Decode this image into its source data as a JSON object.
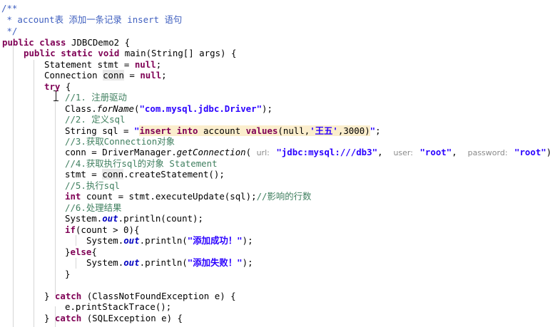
{
  "editor": {
    "lines": [
      {
        "text": "/**"
      },
      {
        "text": " * account表 添加一条记录 insert 语句"
      },
      {
        "text": " */"
      },
      {
        "kw1": "public class",
        "name": "JDBCDemo2 {"
      },
      {
        "kw1": "public static void",
        "rest": "main(String[] args) {"
      },
      {
        "type": "Statement",
        "var": "stmt",
        "eq": " = ",
        "kw": "null",
        "end": ";"
      },
      {
        "type": "Connection",
        "var": "conn",
        "eq": " = ",
        "kw": "null",
        "end": ";"
      },
      {
        "kw": "try",
        "end": " {"
      },
      {
        "comment": "//1. 注册驱动"
      },
      {
        "pre": "Class.",
        "method": "forName",
        "open": "(",
        "str": "\"com.mysql.jdbc.Driver\"",
        "close": ");"
      },
      {
        "comment": "//2. 定义sql"
      },
      {
        "pre": "String sql = ",
        "q1": "\"",
        "sql_kw1": "insert into",
        "sql_mid": " account ",
        "sql_kw2": "values",
        "sql_args_a": "(null,",
        "sql_str": "'王五'",
        "sql_args_b": ",3000)",
        "q2": "\"",
        "end": ";"
      },
      {
        "comment": "//3.获取Connection对象"
      },
      {
        "pre": "conn = DriverManager.",
        "method": "getConnection",
        "open": "(",
        "hint_url": "url:",
        "url": "\"jdbc:mysql:///db3\"",
        "sep1": ",",
        "hint_user": "user:",
        "user": "\"root\"",
        "sep2": ",",
        "hint_pw": "password:",
        "pw": "\"root\"",
        "close": ");"
      },
      {
        "comment": "//4.获取执行sql的对象 Statement"
      },
      {
        "pre": "stmt = ",
        "var": "conn",
        "rest": ".createStatement();"
      },
      {
        "comment": "//5.执行sql"
      },
      {
        "kw": "int",
        "rest": " count = stmt.executeUpdate(sql);",
        "comment": "//影响的行数"
      },
      {
        "comment": "//6.处理结果"
      },
      {
        "pre": "System.",
        "field": "out",
        "rest": ".println(count);"
      },
      {
        "kw": "if",
        "rest": "(count > 0){"
      },
      {
        "pre": "System.",
        "field": "out",
        "rest": ".println(",
        "str": "\"添加成功！\"",
        "close": ");"
      },
      {
        "text": "}",
        "kw": "else",
        "end": "{"
      },
      {
        "pre": "System.",
        "field": "out",
        "rest": ".println(",
        "str": "\"添加失败！\"",
        "close": ");"
      },
      {
        "text": "}"
      },
      {
        "pre": "} ",
        "kw": "catch",
        "rest": " (ClassNotFoundException e) {"
      },
      {
        "text": "e.printStackTrace();"
      },
      {
        "pre": "} ",
        "kw": "catch",
        "rest": " (SQLException e) {"
      }
    ]
  }
}
